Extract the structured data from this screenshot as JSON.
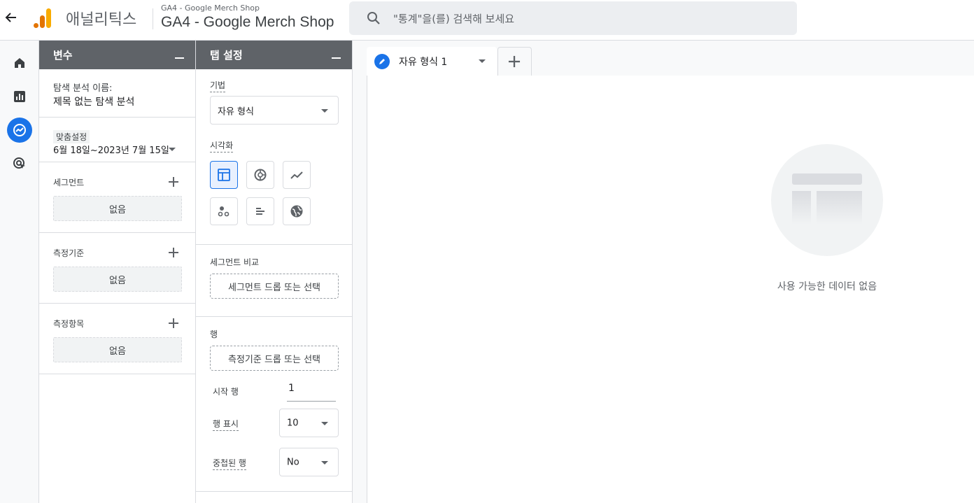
{
  "header": {
    "app_name": "애널리틱스",
    "property_small": "GA4 - Google Merch Shop",
    "property_big": "GA4 - Google Merch Shop",
    "search_placeholder": "\"통계\"을(를) 검색해 보세요"
  },
  "rail": {
    "items": [
      "home-icon",
      "reports-icon",
      "explore-icon",
      "advertising-icon"
    ],
    "active": "explore-icon",
    "accent": "#1a73e8"
  },
  "variables": {
    "title": "변수",
    "exploration_name_label": "탐색 분석 이름:",
    "exploration_name": "제목 없는 탐색 분석",
    "date_chip": "맞춤설정",
    "date_range": "6월 18일~2023년 7월 15일",
    "segments_label": "세그먼트",
    "segments_value": "없음",
    "dimensions_label": "측정기준",
    "dimensions_value": "없음",
    "metrics_label": "측정항목",
    "metrics_value": "없음"
  },
  "tab_settings": {
    "title": "탭 설정",
    "technique_label": "기법",
    "technique_value": "자유 형식",
    "visualization_label": "시각화",
    "visualizations": [
      "table-icon",
      "donut-chart-icon",
      "line-chart-icon",
      "scatter-plot-icon",
      "bar-chart-icon",
      "geo-map-icon"
    ],
    "visualization_selected": "table-icon",
    "segment_compare_label": "세그먼트 비교",
    "segment_compare_button": "세그먼트 드롭 또는 선택",
    "rows_label": "행",
    "rows_button": "측정기준 드롭 또는 선택",
    "start_row_label": "시작 행",
    "start_row_value": "1",
    "show_rows_label": "행 표시",
    "show_rows_value": "10",
    "nested_rows_label": "중첩된 행",
    "nested_rows_value": "No"
  },
  "canvas": {
    "tab_title": "자유 형식 1",
    "empty_message": "사용 가능한 데이터 없음"
  }
}
